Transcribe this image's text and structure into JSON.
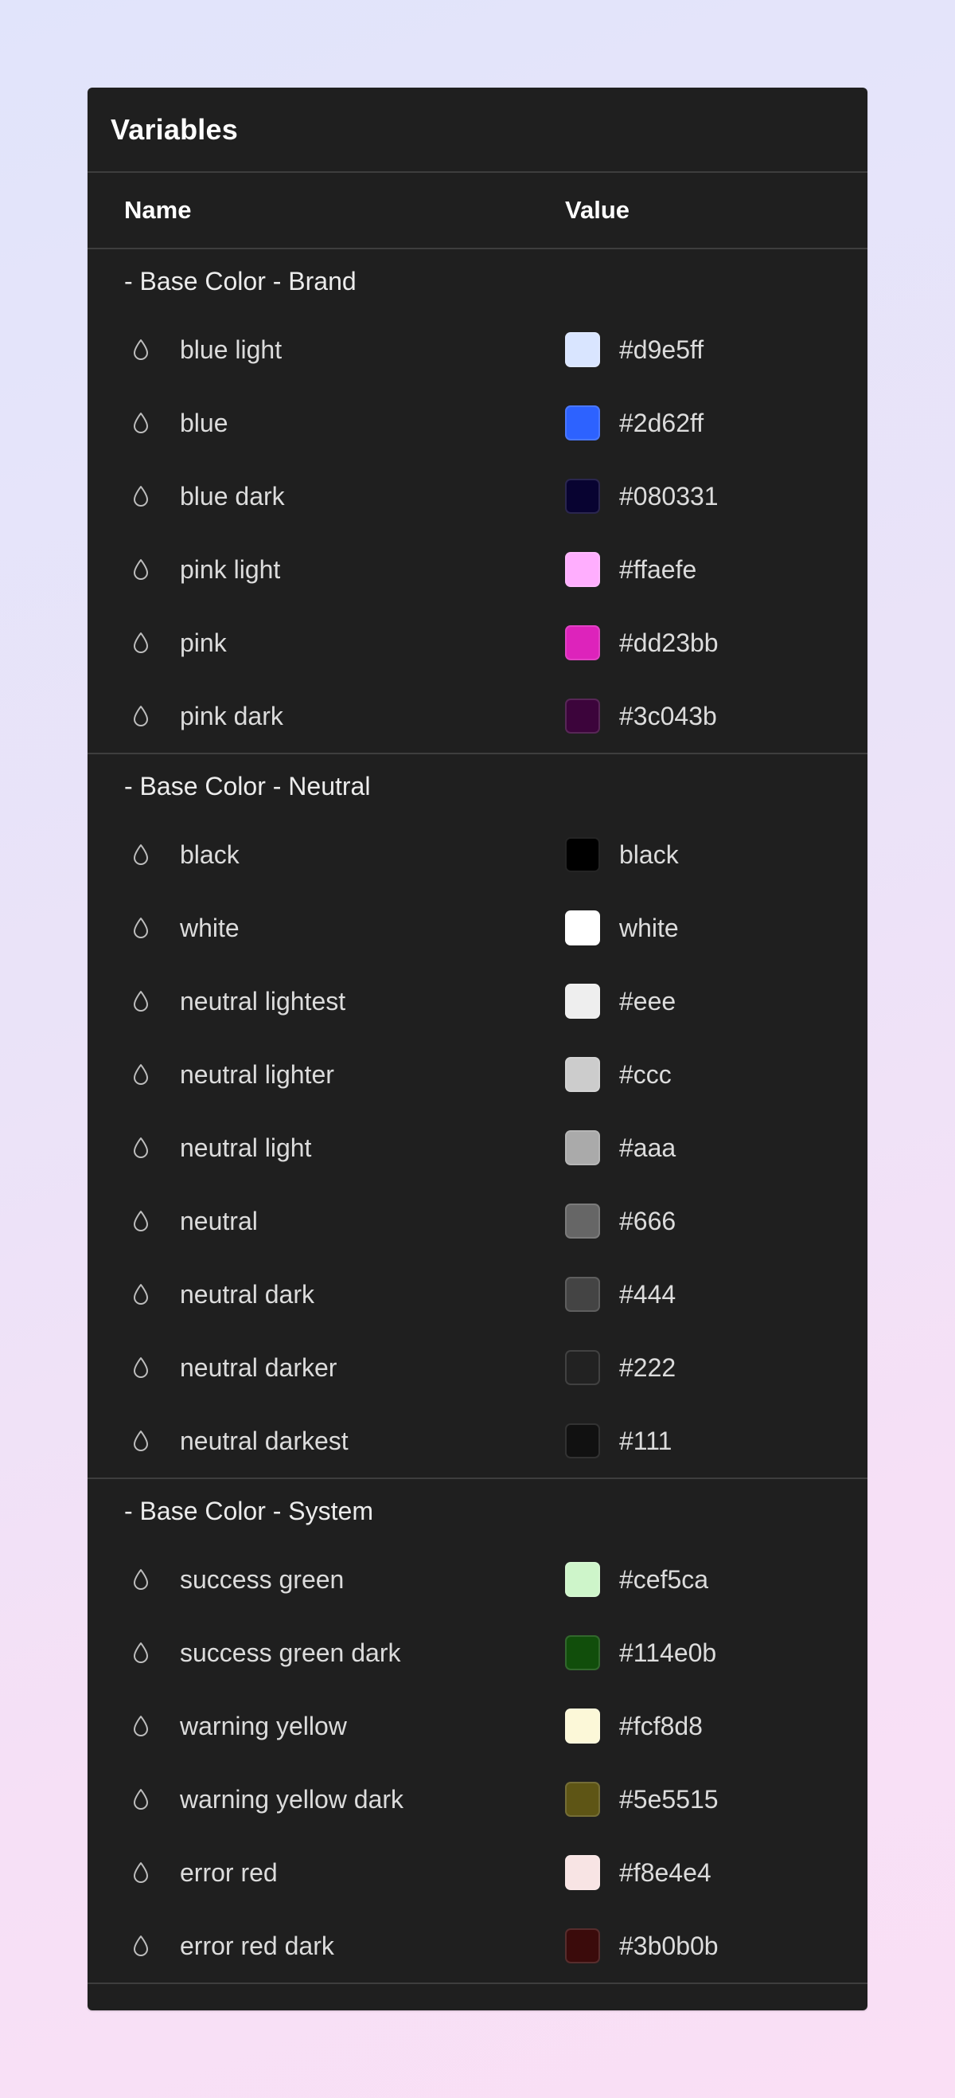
{
  "panel": {
    "title": "Variables",
    "columns": {
      "name": "Name",
      "value": "Value"
    }
  },
  "groups": [
    {
      "title": "- Base Color - Brand",
      "items": [
        {
          "name": "blue light",
          "value": "#d9e5ff",
          "color": "#d9e5ff"
        },
        {
          "name": "blue",
          "value": "#2d62ff",
          "color": "#2d62ff"
        },
        {
          "name": "blue dark",
          "value": "#080331",
          "color": "#080331"
        },
        {
          "name": "pink light",
          "value": "#ffaefe",
          "color": "#ffaefe"
        },
        {
          "name": "pink",
          "value": "#dd23bb",
          "color": "#dd23bb"
        },
        {
          "name": "pink dark",
          "value": "#3c043b",
          "color": "#3c043b"
        }
      ]
    },
    {
      "title": "- Base Color - Neutral",
      "items": [
        {
          "name": "black",
          "value": "black",
          "color": "#000000"
        },
        {
          "name": "white",
          "value": "white",
          "color": "#ffffff"
        },
        {
          "name": "neutral lightest",
          "value": "#eee",
          "color": "#eeeeee"
        },
        {
          "name": "neutral lighter",
          "value": "#ccc",
          "color": "#cccccc"
        },
        {
          "name": "neutral light",
          "value": "#aaa",
          "color": "#aaaaaa"
        },
        {
          "name": "neutral",
          "value": "#666",
          "color": "#666666"
        },
        {
          "name": "neutral dark",
          "value": "#444",
          "color": "#444444"
        },
        {
          "name": "neutral darker",
          "value": "#222",
          "color": "#222222"
        },
        {
          "name": "neutral darkest",
          "value": "#111",
          "color": "#111111"
        }
      ]
    },
    {
      "title": "- Base Color - System",
      "items": [
        {
          "name": "success green",
          "value": "#cef5ca",
          "color": "#cef5ca"
        },
        {
          "name": "success green dark",
          "value": "#114e0b",
          "color": "#114e0b"
        },
        {
          "name": "warning yellow",
          "value": "#fcf8d8",
          "color": "#fcf8d8"
        },
        {
          "name": "warning yellow dark",
          "value": "#5e5515",
          "color": "#5e5515"
        },
        {
          "name": "error red",
          "value": "#f8e4e4",
          "color": "#f8e4e4"
        },
        {
          "name": "error red dark",
          "value": "#3b0b0b",
          "color": "#3b0b0b"
        }
      ]
    }
  ],
  "icons": {
    "row_icon": "droplet-icon"
  },
  "theme": {
    "panel_background": "#1f1f1f",
    "divider": "#3e3e3e"
  }
}
